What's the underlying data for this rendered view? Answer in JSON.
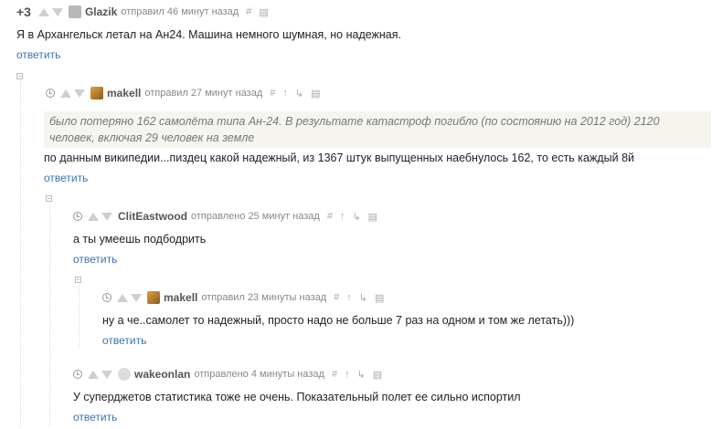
{
  "comments": [
    {
      "rating": "+3",
      "author": "Glazik",
      "meta": "отправил 46 минут назад",
      "text": "Я в Архангельск летал на Ан24. Машина немного шумная, но надежная.",
      "reply": "ответить"
    },
    {
      "author": "makell",
      "meta": "отправил 27 минут назад",
      "quote": "было потеряно 162 самолёта типа Ан-24. В результате катастроф погибло (по состоянию на 2012 год) 2120 человек, включая 29 человек на земле",
      "text": "по данным википедии...пиздец какой надежный, из 1367 штук выпущенных наебнулось 162, то есть каждый 8й",
      "reply": "ответить"
    },
    {
      "author": "ClitEastwood",
      "meta": "отправлено 25 минут назад",
      "text": "а ты умеешь подбодрить",
      "reply": "ответить"
    },
    {
      "author": "makell",
      "meta": "отправил 23 минуты назад",
      "text": "ну а че..самолет то надежный, просто надо не больше 7 раз на одном и том же летать)))",
      "reply": "ответить"
    },
    {
      "author": "wakeonlan",
      "meta": "отправлено 4 минуты назад",
      "text": "У суперджетов статистика тоже не очень. Показательный полет ее сильно испортил",
      "reply": "ответить"
    }
  ],
  "icons": {
    "hash": "#",
    "up_arrow": "↑",
    "branch": "↳",
    "save": "save-icon",
    "clock": "clock-icon"
  }
}
